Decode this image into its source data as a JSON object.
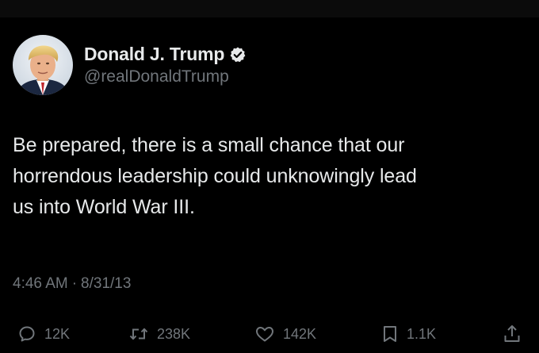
{
  "author": {
    "display_name": "Donald J. Trump",
    "handle": "@realDonaldTrump",
    "verified": true,
    "verified_color": "#1d9bf0"
  },
  "tweet": {
    "text": "Be prepared, there is a small chance that our\nhorrendous leadership could unknowingly lead\nus into World War III.",
    "time": "4:46 AM",
    "separator": "·",
    "date": "8/31/13"
  },
  "actions": {
    "replies": "12K",
    "retweets": "238K",
    "likes": "142K",
    "bookmarks": "1.1K"
  },
  "icons": {
    "reply": "reply-icon",
    "retweet": "retweet-icon",
    "like": "heart-icon",
    "bookmark": "bookmark-icon",
    "share": "share-icon",
    "verified": "verified-badge-icon"
  },
  "colors": {
    "background": "#000000",
    "text_primary": "#e7e9ea",
    "text_secondary": "#71767b"
  }
}
